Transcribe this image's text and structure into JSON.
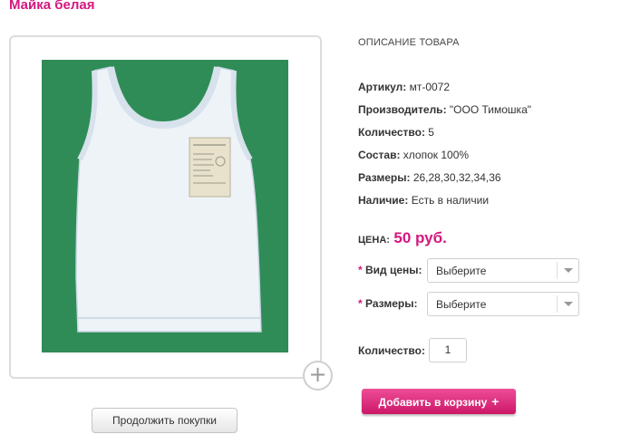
{
  "product": {
    "title": "Майка белая"
  },
  "description": {
    "heading": "ОПИСАНИЕ ТОВАРА",
    "specs": [
      {
        "label": "Артикул:",
        "value": "мт-0072"
      },
      {
        "label": "Производитель:",
        "value": "\"ООО Тимошка\""
      },
      {
        "label": "Количество:",
        "value": "5"
      },
      {
        "label": "Состав:",
        "value": "хлопок 100%"
      },
      {
        "label": "Размеры:",
        "value": "26,28,30,32,34,36"
      },
      {
        "label": "Наличие:",
        "value": "Есть в наличии"
      }
    ]
  },
  "price": {
    "label": "ЦЕНА:",
    "value": "50 руб."
  },
  "options": [
    {
      "star": "*",
      "label": "Вид цены:",
      "selected": "Выберите"
    },
    {
      "star": "*",
      "label": "Размеры:",
      "selected": "Выберите"
    }
  ],
  "quantity": {
    "label": "Количество:",
    "value": "1"
  },
  "buttons": {
    "add_to_cart": "Добавить в корзину",
    "add_to_cart_icon": "+",
    "continue_shopping": "Продолжить покупки",
    "zoom_icon": "+"
  },
  "colors": {
    "accent": "#d4177f",
    "photo_background": "#2f8c57"
  },
  "icons": {
    "zoom": "plus-icon",
    "dropdown": "chevron-down-icon"
  }
}
